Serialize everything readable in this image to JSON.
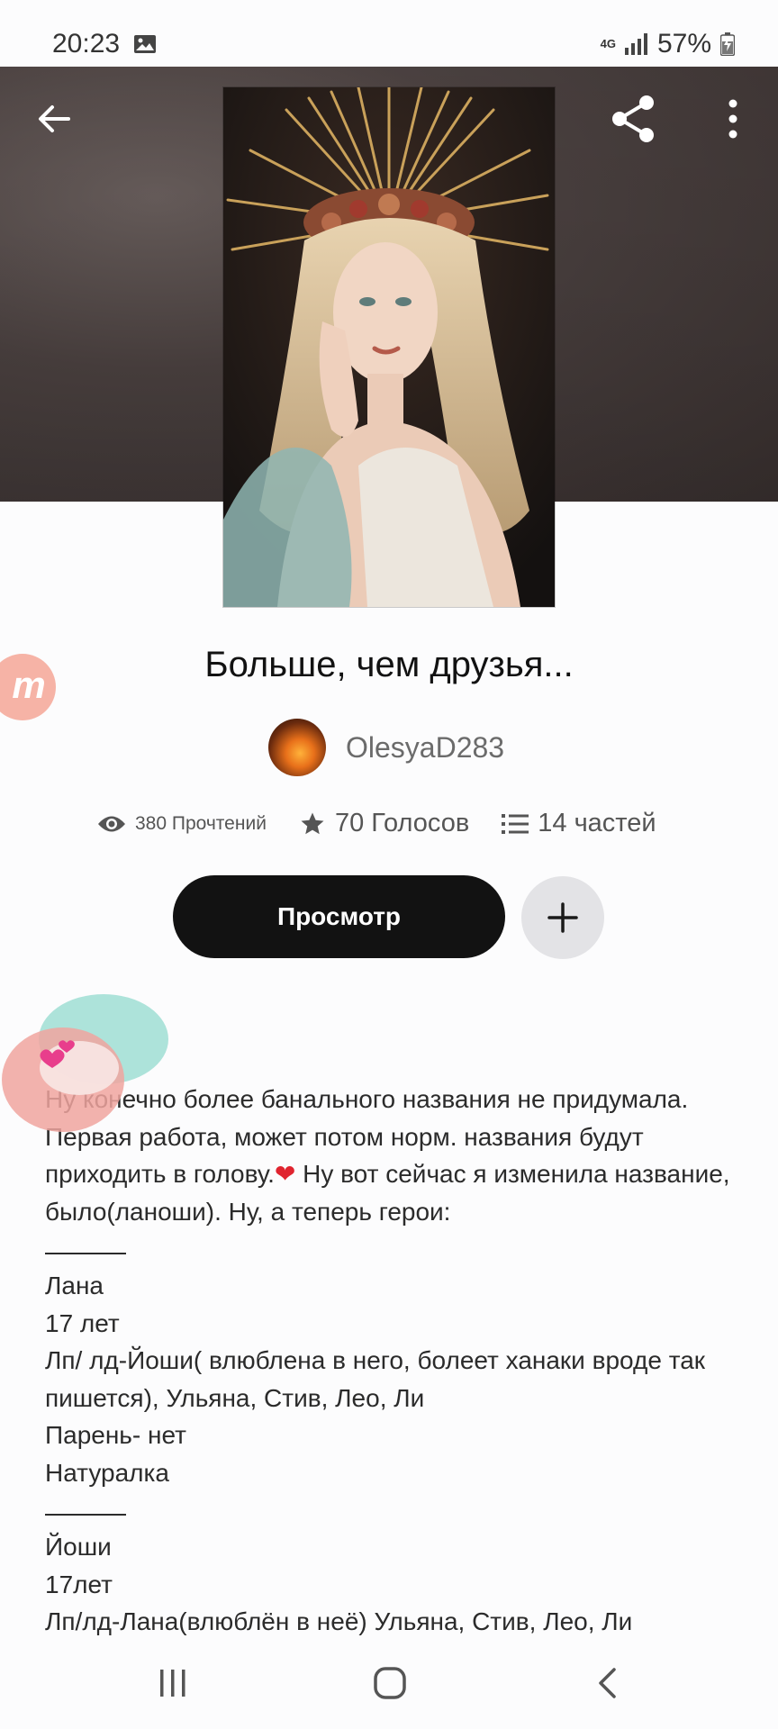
{
  "status_bar": {
    "time": "20:23",
    "network": "4G",
    "battery": "57%"
  },
  "story": {
    "title": "Больше, чем друзья...",
    "author": "OlesyaD283",
    "reads": "380 Прочтений",
    "votes": "70 Голосов",
    "parts": "14 частей"
  },
  "actions": {
    "read_label": "Просмотр"
  },
  "description": {
    "intro": "Ну конечно более банального названия не придумала. Первая работа, может потом норм. названия будут приходить в голову.",
    "intro2": " Ну вот сейчас я изменила название, было(ланоши). Ну, а теперь герои:",
    "heart": "❤",
    "characters": [
      {
        "lines": [
          "Лана",
          "17 лет",
          "Лп/ лд-Йоши( влюблена в него, болеет ханаки вроде так пишется),  Ульяна, Стив, Лео, Ли",
          "Парень- нет",
          "Натуралка"
        ]
      },
      {
        "lines": [
          "Йоши",
          "17лет",
          "Лп/лд-Лана(влюблён в неё)  Ульяна, Стив, Лео, Ли"
        ]
      }
    ]
  },
  "icons": {
    "back": "arrow-left-icon",
    "share": "share-icon",
    "more": "more-vertical-icon",
    "eye": "eye-icon",
    "star": "star-icon",
    "list": "list-icon",
    "add": "plus-icon"
  }
}
